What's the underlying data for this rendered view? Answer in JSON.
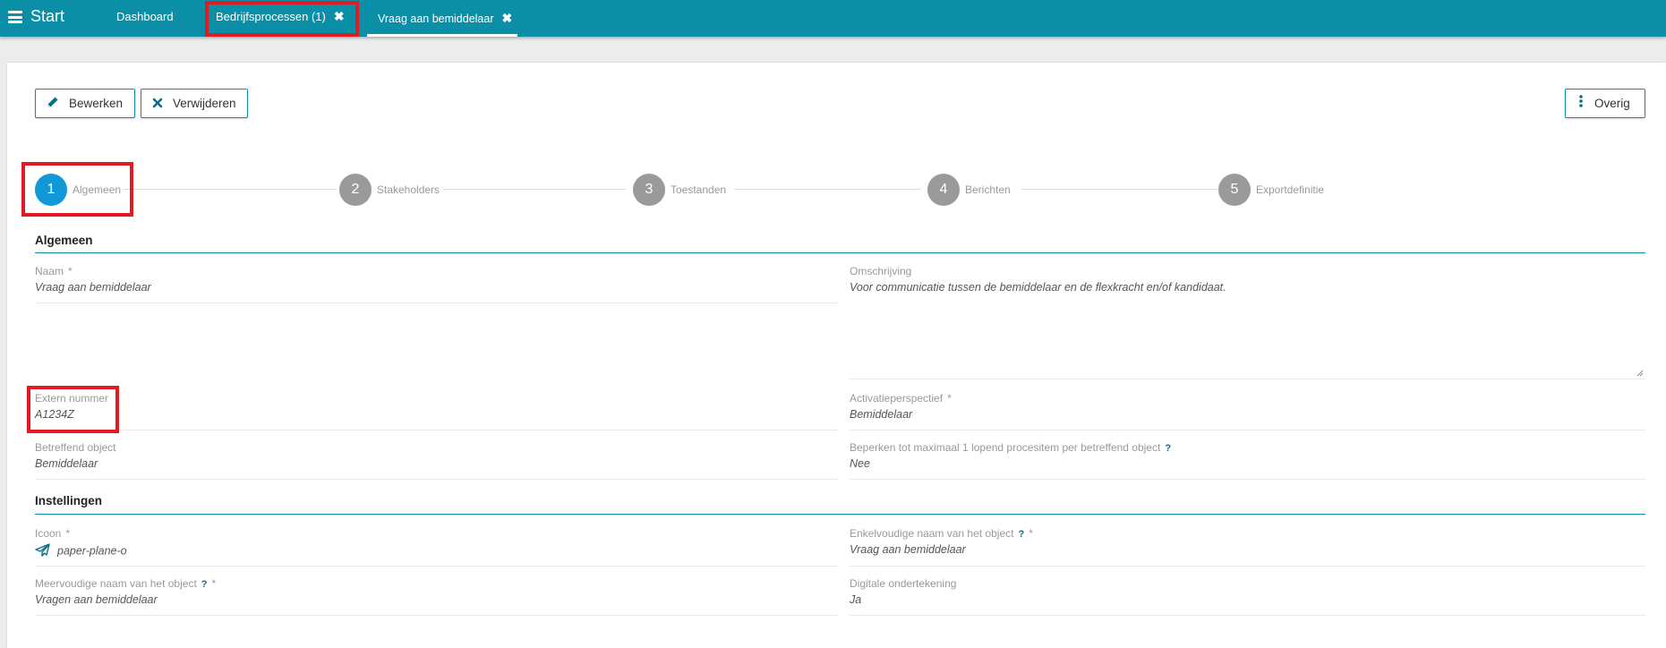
{
  "topbar": {
    "start_label": "Start",
    "tabs": [
      {
        "label": "Dashboard"
      },
      {
        "label": "Bedrijfsprocessen (1)",
        "close": "✖"
      },
      {
        "label": "Vraag aan bemiddelaar",
        "close": "✖"
      }
    ]
  },
  "toolbar": {
    "edit_label": "Bewerken",
    "delete_label": "Verwijderen",
    "more_label": "Overig"
  },
  "steps": [
    {
      "number": "1",
      "label": "Algemeen",
      "active": true
    },
    {
      "number": "2",
      "label": "Stakeholders"
    },
    {
      "number": "3",
      "label": "Toestanden"
    },
    {
      "number": "4",
      "label": "Berichten"
    },
    {
      "number": "5",
      "label": "Exportdefinitie"
    }
  ],
  "sections": {
    "algemeen": {
      "title": "Algemeen",
      "naam": {
        "label": "Naam",
        "required": "*",
        "value": "Vraag aan bemiddelaar"
      },
      "omschrijving": {
        "label": "Omschrijving",
        "value": "Voor communicatie tussen de bemiddelaar en de flexkracht en/of kandidaat."
      },
      "extern_nummer": {
        "label": "Extern nummer",
        "value": "A1234Z"
      },
      "activatieperspectief": {
        "label": "Activatieperspectief",
        "required": "*",
        "value": "Bemiddelaar"
      },
      "betreffend_object": {
        "label": "Betreffend object",
        "value": "Bemiddelaar"
      },
      "beperken": {
        "label": "Beperken tot maximaal 1 lopend procesitem per betreffend object",
        "help": "?",
        "value": "Nee"
      }
    },
    "instellingen": {
      "title": "Instellingen",
      "icoon": {
        "label": "Icoon",
        "required": "*",
        "value": "paper-plane-o"
      },
      "enkelvoudige_naam": {
        "label": "Enkelvoudige naam van het object",
        "help": "?",
        "required": "*",
        "value": "Vraag aan bemiddelaar"
      },
      "meervoudige_naam": {
        "label": "Meervoudige naam van het object",
        "help": "?",
        "required": "*",
        "value": "Vragen aan bemiddelaar"
      },
      "digitale_ondertekening": {
        "label": "Digitale ondertekening",
        "value": "Ja"
      }
    }
  },
  "colors": {
    "topbar": "#0a8fa7",
    "active_step": "#1198d6",
    "inactive_step": "#9a9a9a",
    "highlight": "#e01b24"
  }
}
